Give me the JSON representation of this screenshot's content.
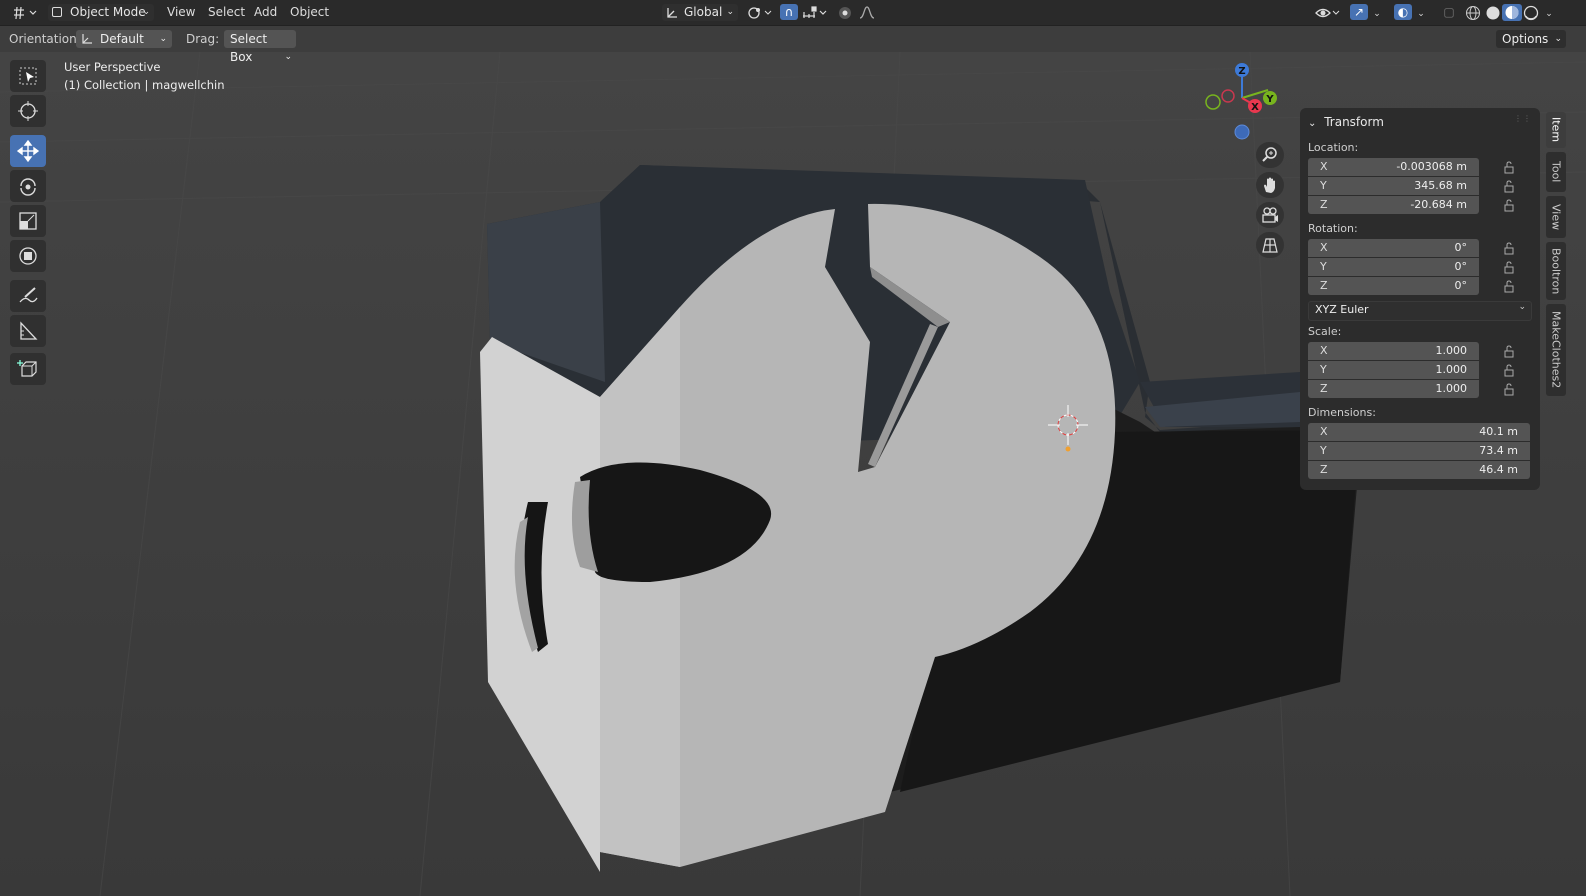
{
  "header": {
    "mode_label": "Object Mode",
    "menus": [
      "View",
      "Select",
      "Add",
      "Object"
    ],
    "transform_orientation": "Global"
  },
  "tool_options": {
    "orientation_label": "Orientation:",
    "orientation_value": "Default",
    "drag_label": "Drag:",
    "drag_value": "Select Box",
    "options_label": "Options"
  },
  "viewport": {
    "perspective_label": "User Perspective",
    "collection_label": "(1) Collection | magwellchin"
  },
  "gizmo": {
    "z": "Z",
    "x": "X",
    "y": "Y"
  },
  "npanel": {
    "title": "Transform",
    "location_label": "Location:",
    "location": [
      {
        "axis": "X",
        "value": "-0.003068 m"
      },
      {
        "axis": "Y",
        "value": "345.68 m"
      },
      {
        "axis": "Z",
        "value": "-20.684 m"
      }
    ],
    "rotation_label": "Rotation:",
    "rotation": [
      {
        "axis": "X",
        "value": "0°"
      },
      {
        "axis": "Y",
        "value": "0°"
      },
      {
        "axis": "Z",
        "value": "0°"
      }
    ],
    "rotation_mode": "XYZ Euler",
    "scale_label": "Scale:",
    "scale": [
      {
        "axis": "X",
        "value": "1.000"
      },
      {
        "axis": "Y",
        "value": "1.000"
      },
      {
        "axis": "Z",
        "value": "1.000"
      }
    ],
    "dimensions_label": "Dimensions:",
    "dimensions": [
      {
        "axis": "X",
        "value": "40.1 m"
      },
      {
        "axis": "Y",
        "value": "73.4 m"
      },
      {
        "axis": "Z",
        "value": "46.4 m"
      }
    ]
  },
  "side_tabs": [
    "Item",
    "Tool",
    "View",
    "Booltron",
    "MakeClothes2"
  ],
  "colors": {
    "accent": "#4772b3",
    "axis_x": "#e8384f",
    "axis_y": "#78b41e",
    "axis_z": "#3d7ad8",
    "header_bg": "#2a2a2a",
    "viewport_bg": "#3d3d3d"
  },
  "icons": {
    "editor_type": "view3d-icon",
    "tools": [
      "select-box-icon",
      "cursor-icon",
      "move-icon",
      "rotate-icon",
      "scale-icon",
      "transform-icon",
      "annotate-icon",
      "measure-icon",
      "add-cube-icon"
    ],
    "navigation": [
      "zoom-icon",
      "pan-hand-icon",
      "camera-icon",
      "ortho-grid-icon"
    ]
  }
}
